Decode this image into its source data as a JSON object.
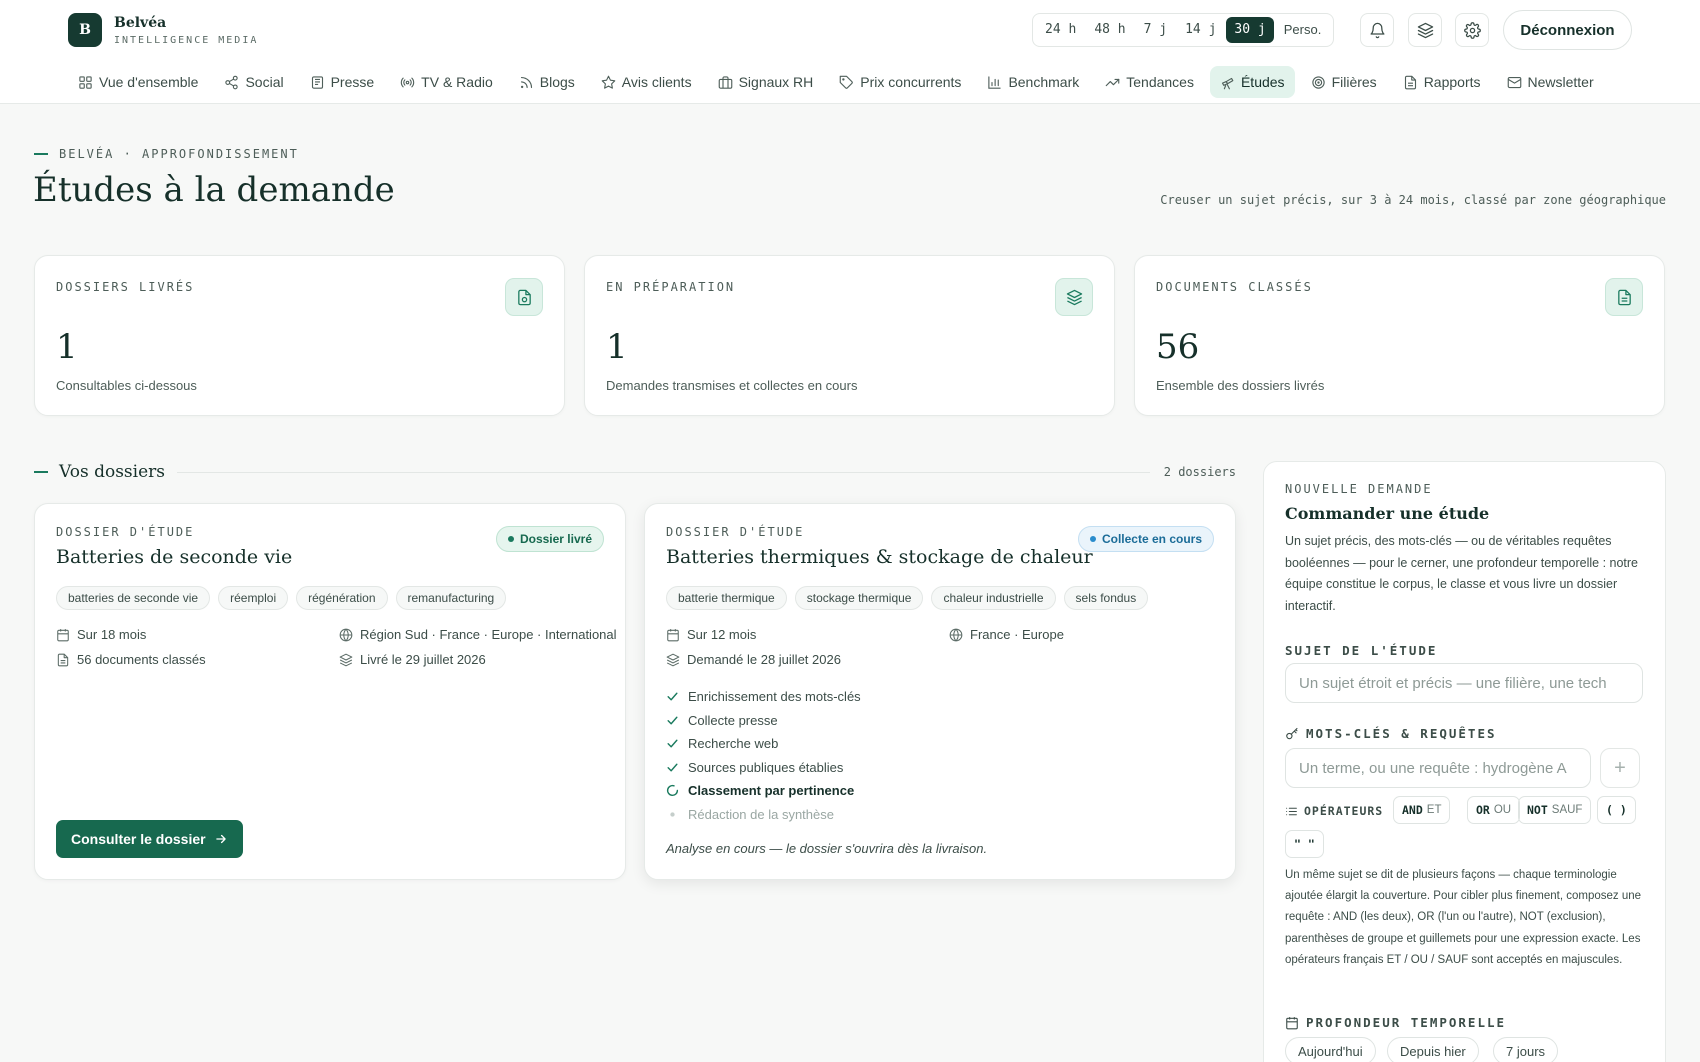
{
  "brand": {
    "logo_letter": "B",
    "name": "Belvéa",
    "subtitle": "INTELLIGENCE MEDIA"
  },
  "time_ranges": [
    {
      "label": "24 h",
      "active": false
    },
    {
      "label": "48 h",
      "active": false
    },
    {
      "label": "7 j",
      "active": false
    },
    {
      "label": "14 j",
      "active": false
    },
    {
      "label": "30 j",
      "active": true
    },
    {
      "label": "Perso.",
      "active": false
    }
  ],
  "header_actions": {
    "logout_label": "Déconnexion"
  },
  "nav": [
    {
      "label": "Vue d'ensemble",
      "icon": "grid-icon"
    },
    {
      "label": "Social",
      "icon": "share-icon"
    },
    {
      "label": "Presse",
      "icon": "newspaper-icon"
    },
    {
      "label": "TV & Radio",
      "icon": "broadcast-icon"
    },
    {
      "label": "Blogs",
      "icon": "rss-icon"
    },
    {
      "label": "Avis clients",
      "icon": "star-icon"
    },
    {
      "label": "Signaux RH",
      "icon": "briefcase-icon"
    },
    {
      "label": "Prix concurrents",
      "icon": "tag-icon"
    },
    {
      "label": "Benchmark",
      "icon": "bar-chart-icon"
    },
    {
      "label": "Tendances",
      "icon": "trending-icon"
    },
    {
      "label": "Études",
      "icon": "telescope-icon",
      "active": true
    },
    {
      "label": "Filières",
      "icon": "target-icon"
    },
    {
      "label": "Rapports",
      "icon": "file-icon"
    },
    {
      "label": "Newsletter",
      "icon": "mail-icon"
    }
  ],
  "page": {
    "eyebrow": "BELVÉA · APPROFONDISSEMENT",
    "title": "Études à la demande",
    "subtitle": "Creuser un sujet précis, sur 3 à 24 mois, classé par zone géographique"
  },
  "stats": [
    {
      "label": "DOSSIERS LIVRÉS",
      "value": "1",
      "description": "Consultables ci-dessous",
      "icon": "file-check-icon"
    },
    {
      "label": "EN PRÉPARATION",
      "value": "1",
      "description": "Demandes transmises et collectes en cours",
      "icon": "layers-icon"
    },
    {
      "label": "DOCUMENTS CLASSÉS",
      "value": "56",
      "description": "Ensemble des dossiers livrés",
      "icon": "document-icon"
    }
  ],
  "section": {
    "title": "Vos dossiers",
    "count": "2 dossiers"
  },
  "dossiers": [
    {
      "kicker": "DOSSIER D'ÉTUDE",
      "title": "Batteries de seconde vie",
      "status": "Dossier livré",
      "status_color": "#1a7a5e",
      "tags": [
        "batteries de seconde vie",
        "réemploi",
        "régénération",
        "remanufacturing"
      ],
      "period": "Sur 18 mois",
      "zones": "Région Sud · France · Europe · International",
      "documents": "56 documents classés",
      "date": "Livré le 29 juillet 2026",
      "cta_label": "Consulter le dossier"
    },
    {
      "kicker": "DOSSIER D'ÉTUDE",
      "title": "Batteries thermiques & stockage de chaleur",
      "status": "Collecte en cours",
      "status_color": "#2a8ccc",
      "tags": [
        "batterie thermique",
        "stockage thermique",
        "chaleur industrielle",
        "sels fondus"
      ],
      "period": "Sur 12 mois",
      "zones": "France · Europe",
      "date": "Demandé le 28 juillet 2026",
      "steps": [
        {
          "label": "Enrichissement des mots-clés",
          "state": "done"
        },
        {
          "label": "Collecte presse",
          "state": "done"
        },
        {
          "label": "Recherche web",
          "state": "done"
        },
        {
          "label": "Sources publiques établies",
          "state": "done"
        },
        {
          "label": "Classement par pertinence",
          "state": "current"
        },
        {
          "label": "Rédaction de la synthèse",
          "state": "pending"
        }
      ],
      "note": "Analyse en cours — le dossier s'ouvrira dès la livraison."
    }
  ],
  "form": {
    "kicker": "NOUVELLE DEMANDE",
    "title": "Commander une étude",
    "description": "Un sujet précis, des mots-clés — ou de véritables requêtes booléennes — pour le cerner, une profondeur temporelle : notre équipe constitue le corpus, le classe et vous livre un dossier interactif.",
    "subject_label": "SUJET DE L'ÉTUDE",
    "subject_placeholder": "Un sujet étroit et précis — une filière, une tech",
    "keywords_label": "MOTS-CLÉS & REQUÊTES",
    "keywords_placeholder": "Un terme, ou une requête : hydrogène A",
    "add_symbol": "+",
    "operators_label": "OPÉRATEURS",
    "operators": [
      {
        "op": "AND",
        "fr": "ET"
      },
      {
        "op": "OR",
        "fr": "OU"
      },
      {
        "op": "NOT",
        "fr": "SAUF"
      },
      {
        "op": "( )",
        "fr": ""
      },
      {
        "op": "\" \"",
        "fr": ""
      }
    ],
    "help": "Un même sujet se dit de plusieurs façons — chaque terminologie ajoutée élargit la couverture. Pour cibler plus finement, composez une requête : AND (les deux), OR (l'un ou l'autre), NOT (exclusion), parenthèses de groupe et guillemets pour une expression exacte. Les opérateurs français ET / OU / SAUF sont acceptés en majuscules.",
    "depth_label": "PROFONDEUR TEMPORELLE",
    "depth_options": [
      "Aujourd'hui",
      "Depuis hier",
      "7 jours"
    ]
  }
}
